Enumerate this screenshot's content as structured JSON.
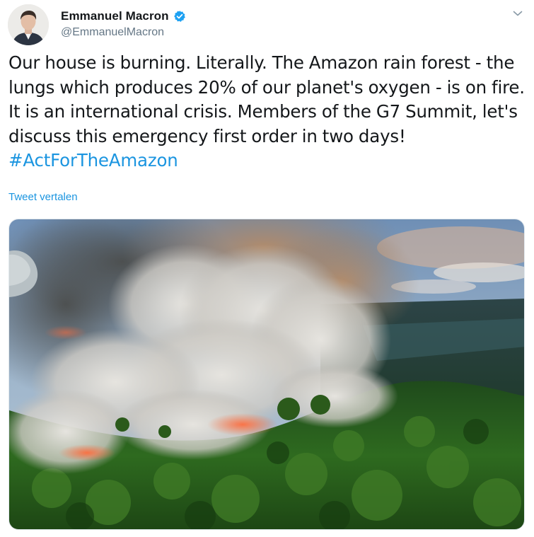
{
  "author": {
    "name": "Emmanuel Macron",
    "handle": "@EmmanuelMacron",
    "verified": true,
    "avatar_icon": "profile-photo"
  },
  "tweet": {
    "text": "Our house is burning. Literally. The Amazon rain forest - the lungs which produces 20% of our planet's oxygen - is on fire. It is an international crisis. Members of the G7 Summit, let's discuss this emergency first order in two days! ",
    "hashtag": "#ActForTheAmazon",
    "translate_label": "Tweet vertalen"
  },
  "media": {
    "description_icon": "amazon-fire-photo"
  },
  "colors": {
    "link": "#1b95e0",
    "text": "#14171a",
    "secondary": "#657786",
    "verified_badge": "#1da1f2"
  }
}
